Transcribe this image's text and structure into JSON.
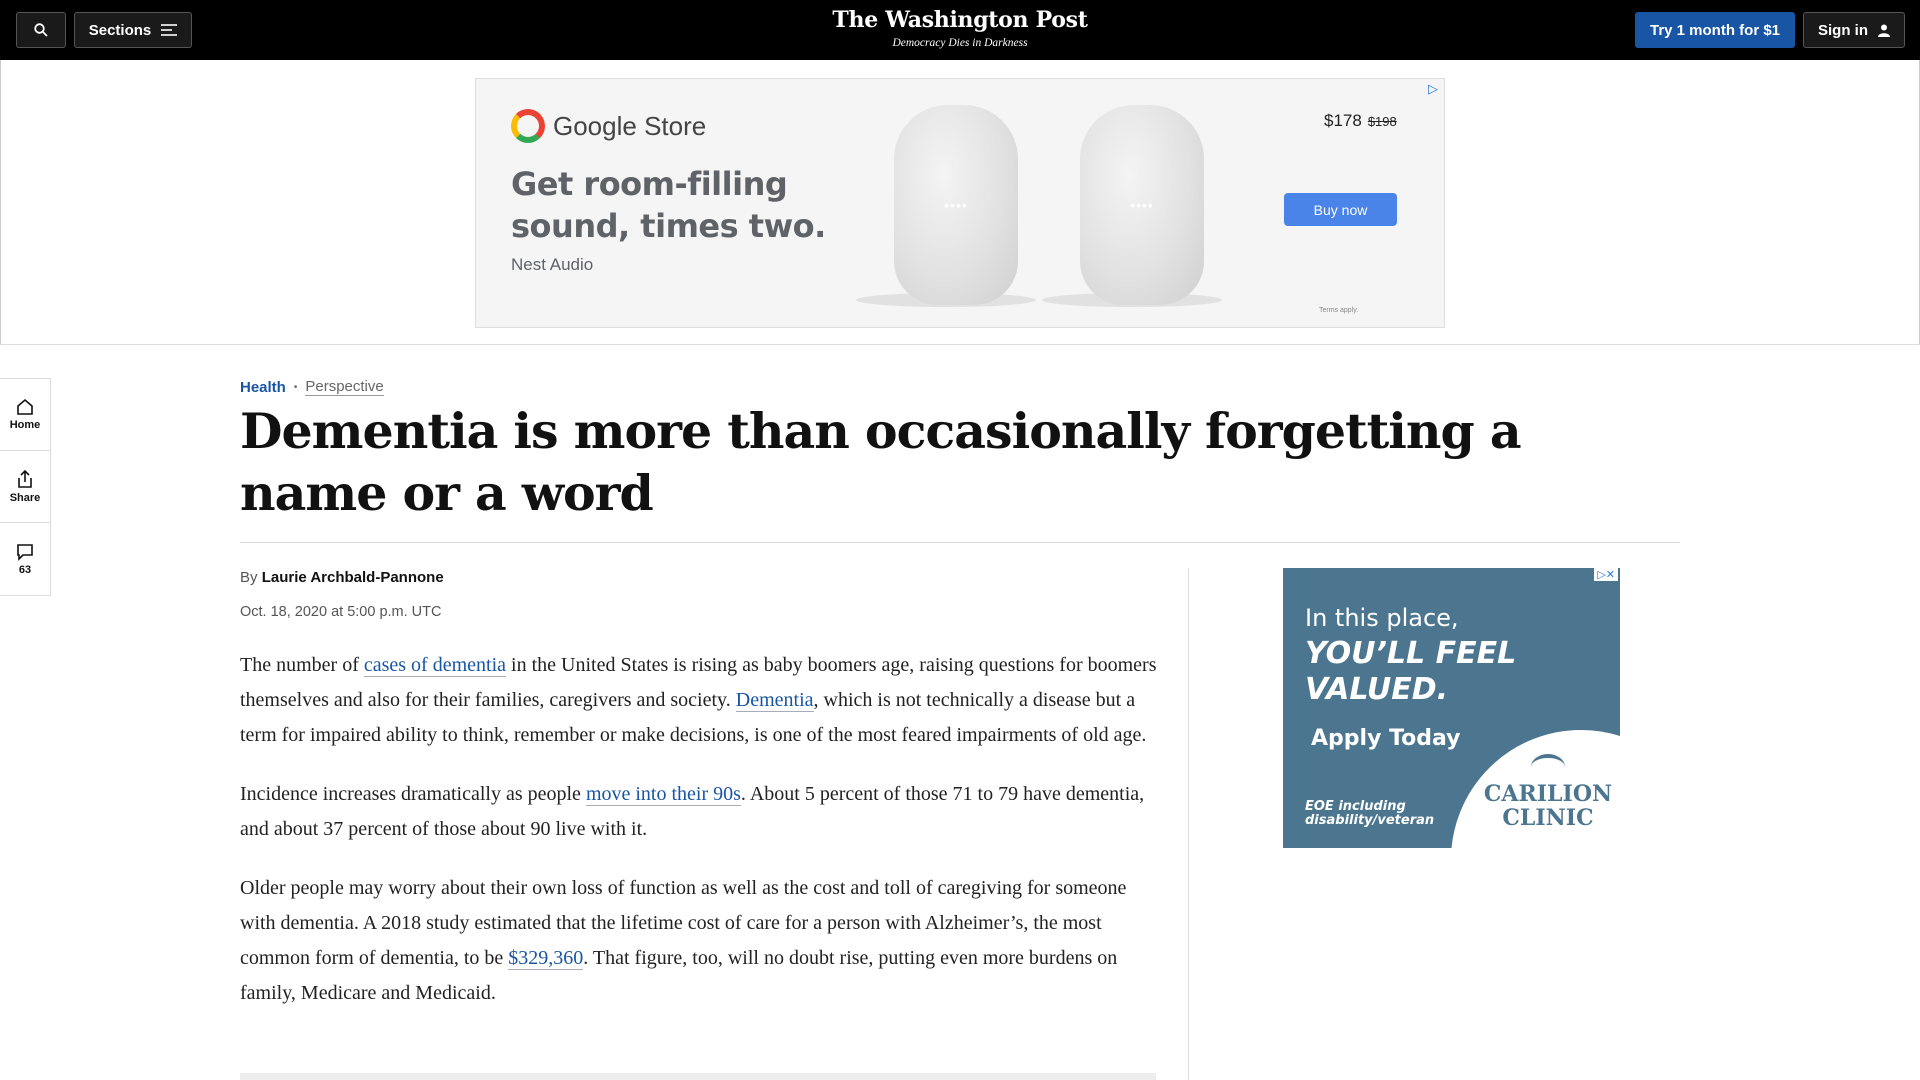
{
  "header": {
    "sections_label": "Sections",
    "logo_text": "The Washington Post",
    "tagline": "Democracy Dies in Darkness",
    "subscribe_label": "Try 1 month for $1",
    "signin_label": "Sign in"
  },
  "top_ad": {
    "brand": "Google Store",
    "headline": "Get room-filling sound, times two.",
    "product": "Nest Audio",
    "price": "$178",
    "old_price": "$198",
    "cta": "Buy now",
    "terms": "Terms apply."
  },
  "rail": {
    "home_label": "Home",
    "share_label": "Share",
    "comments_count": "63"
  },
  "article": {
    "section": "Health",
    "label": "Perspective",
    "headline": "Dementia is more than occasionally forgetting a name or a word",
    "by": "By",
    "author": "Laurie Archbald-Pannone",
    "date": "Oct. 18, 2020 at 5:00 p.m. UTC",
    "p1": {
      "t1": "The number of ",
      "link1": "cases of dementia",
      "t2": " in the United States is rising as baby boomers age, raising questions for boomers themselves and also for their families, caregivers and society. ",
      "link2": "Dementia",
      "t3": ", which is not technically a disease but a term for impaired ability to think, remember or make decisions, is one of the most feared impairments of old age."
    },
    "p2": {
      "t1": "Incidence increases dramatically as people ",
      "link1": "move into their 90s",
      "t2": ". About 5 percent of those 71 to 79 have dementia, and about 37 percent of those about 90 live with it."
    },
    "p3": {
      "t1": "Older people may worry about their own loss of function as well as the cost and toll of caregiving for someone with dementia. A 2018 study estimated that the lifetime cost of care for a person with Alzheimer’s, the most common form of dementia, to be ",
      "link1": "$329,360",
      "t2": ". That figure, too, will no doubt rise, putting even more burdens on family, Medicare and Medicaid."
    }
  },
  "side_ad": {
    "line1": "In this place,",
    "line2": "YOU’LL FEEL VALUED.",
    "line3": "Apply Today",
    "line4": "EOE including disability/veteran",
    "brand": "CARILION CLINIC"
  },
  "colors": {
    "accent": "#1955a5",
    "header_bg": "#000000",
    "side_ad_bg": "#4c7690",
    "buy_button": "#4a84e8"
  }
}
